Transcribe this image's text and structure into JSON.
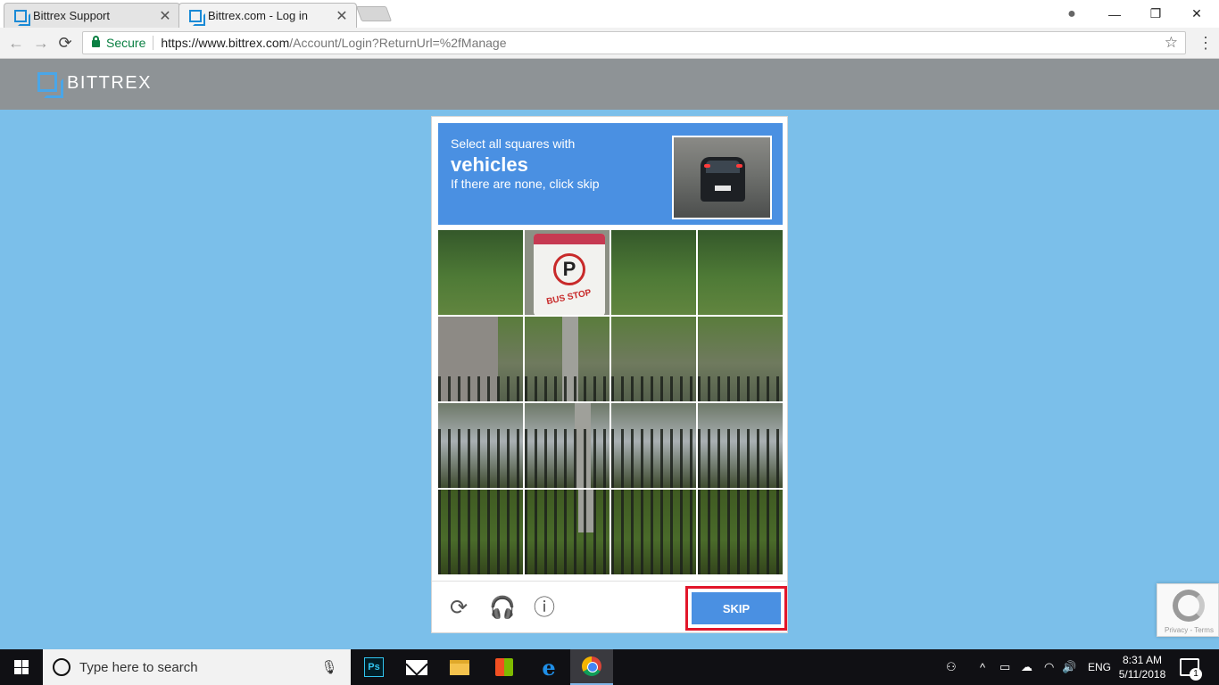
{
  "browser": {
    "tabs": [
      {
        "title": "Bittrex Support",
        "close": "✕"
      },
      {
        "title": "Bittrex.com - Log in",
        "close": "✕"
      }
    ],
    "security_label": "Secure",
    "url_host": "https://www.bittrex.com",
    "url_path": "/Account/Login?ReturnUrl=%2fManage",
    "icons": {
      "back": "←",
      "forward": "→",
      "reload": "⟳",
      "bookmark": "☆",
      "menu": "⋮",
      "profile": "●",
      "minimize": "—",
      "restore": "❐",
      "close": "✕"
    }
  },
  "site": {
    "logo_text": "BITTREX",
    "brand_color": "#4aa6e8",
    "background_color": "#7bbfea"
  },
  "captcha": {
    "instruction": "Select all squares with",
    "target": "vehicles",
    "hint": "If there are none, click skip",
    "sign_letter": "P",
    "sign_text": "BUS STOP",
    "skip_label": "SKIP",
    "accent_color": "#4a90e2",
    "icons": {
      "reload": "⟳",
      "audio": "🎧",
      "info": "ⓘ"
    }
  },
  "recaptcha_badge": {
    "links": "Privacy - Terms"
  },
  "taskbar": {
    "search_placeholder": "Type here to search",
    "ps_label": "Ps",
    "edge_label": "e",
    "language": "ENG",
    "time": "8:31 AM",
    "date": "5/11/2018",
    "notification_count": "1",
    "tray_icons": {
      "people": "⚇",
      "chevron": "^",
      "battery": "▭",
      "cloud": "☁",
      "wifi": "◠",
      "volume": "🔊",
      "mic": "🎙"
    }
  }
}
